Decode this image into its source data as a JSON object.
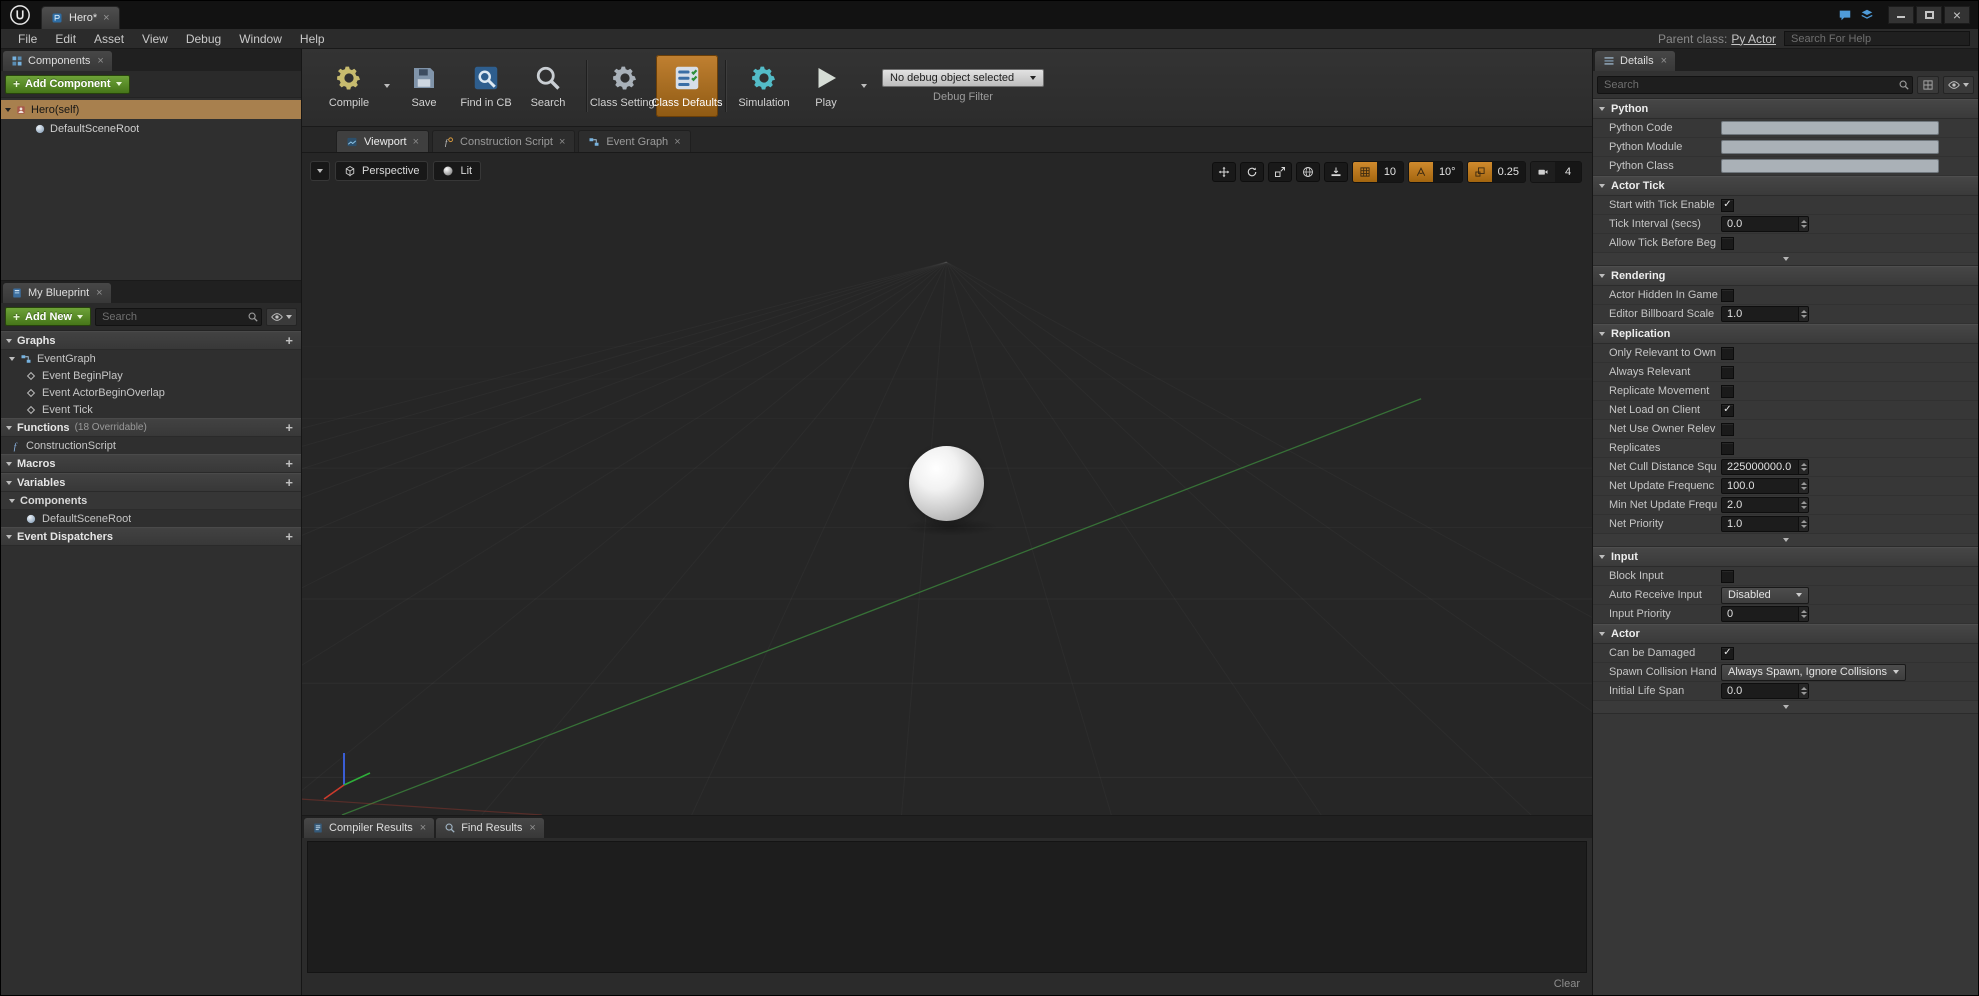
{
  "titlebar": {
    "tab_title": "Hero*"
  },
  "menubar": {
    "items": [
      "File",
      "Edit",
      "Asset",
      "View",
      "Debug",
      "Window",
      "Help"
    ],
    "parent_class_label": "Parent class:",
    "parent_class_value": "Py Actor",
    "help_search_placeholder": "Search For Help"
  },
  "components_panel": {
    "tab_label": "Components",
    "add_button_label": "Add Component",
    "tree": [
      {
        "label": "Hero(self)",
        "icon": "actor",
        "depth": 0,
        "caret": true,
        "selected": true
      },
      {
        "label": "DefaultSceneRoot",
        "icon": "scene-root",
        "depth": 1,
        "caret": false,
        "selected": false
      }
    ]
  },
  "my_blueprint_panel": {
    "tab_label": "My Blueprint",
    "add_new_label": "Add New",
    "search_placeholder": "Search",
    "sections": [
      {
        "title": "Graphs",
        "items": [
          {
            "label": "EventGraph",
            "depth": 0,
            "icon": "graph",
            "caret": true
          },
          {
            "label": "Event BeginPlay",
            "depth": 1,
            "icon": "event"
          },
          {
            "label": "Event ActorBeginOverlap",
            "depth": 1,
            "icon": "event"
          },
          {
            "label": "Event Tick",
            "depth": 1,
            "icon": "event"
          }
        ]
      },
      {
        "title": "Functions",
        "suffix": "(18 Overridable)",
        "items": [
          {
            "label": "ConstructionScript",
            "depth": 0,
            "icon": "function"
          }
        ]
      },
      {
        "title": "Macros",
        "items": []
      },
      {
        "title": "Variables",
        "items": [
          {
            "label": "Components",
            "depth": 0,
            "subheader": true,
            "caret": true
          },
          {
            "label": "DefaultSceneRoot",
            "depth": 1,
            "icon": "component"
          }
        ]
      },
      {
        "title": "Event Dispatchers",
        "items": []
      }
    ]
  },
  "toolbar": {
    "buttons": [
      {
        "label": "Compile",
        "icon": "compile",
        "has_dropdown": true
      },
      {
        "label": "Save",
        "icon": "save"
      },
      {
        "label": "Find in CB",
        "icon": "find-in-cb"
      },
      {
        "label": "Search",
        "icon": "search",
        "sep_after": true
      },
      {
        "label": "Class Settings",
        "icon": "class-settings"
      },
      {
        "label": "Class Defaults",
        "icon": "class-defaults",
        "active": true,
        "sep_after": true
      },
      {
        "label": "Simulation",
        "icon": "simulation"
      },
      {
        "label": "Play",
        "icon": "play",
        "has_dropdown": true
      }
    ],
    "debug_object_dropdown": "No debug object selected",
    "debug_filter_label": "Debug Filter"
  },
  "editor_tabs": [
    {
      "label": "Viewport",
      "icon": "viewport-tab",
      "active": true
    },
    {
      "label": "Construction Script",
      "icon": "construction-script-tab",
      "active": false
    },
    {
      "label": "Event Graph",
      "icon": "event-graph-tab",
      "active": false
    }
  ],
  "viewport": {
    "perspective_label": "Perspective",
    "lit_label": "Lit",
    "right_toolbar": [
      {
        "name": "move",
        "type": "icon"
      },
      {
        "name": "rotate",
        "type": "icon"
      },
      {
        "name": "scale",
        "type": "icon"
      },
      {
        "name": "world",
        "type": "icon"
      },
      {
        "name": "surface-snap",
        "type": "icon"
      },
      {
        "name": "grid-snap",
        "type": "chip",
        "value": "10",
        "active": true
      },
      {
        "name": "rotation-snap",
        "type": "chip",
        "value": "10°",
        "active": true
      },
      {
        "name": "scale-snap",
        "type": "chip",
        "value": "0.25",
        "active": true
      },
      {
        "name": "camera-speed",
        "type": "chip",
        "value": "4",
        "active": false
      }
    ]
  },
  "bottom_panel": {
    "tabs": [
      {
        "label": "Compiler Results",
        "icon": "compiler-results",
        "active": true
      },
      {
        "label": "Find Results",
        "icon": "find-results",
        "active": false
      }
    ],
    "clear_label": "Clear"
  },
  "details_panel": {
    "tab_label": "Details",
    "search_placeholder": "Search",
    "sections": [
      {
        "title": "Python",
        "rows": [
          {
            "label": "Python Code",
            "control": "text",
            "value": ""
          },
          {
            "label": "Python Module",
            "control": "text",
            "value": ""
          },
          {
            "label": "Python Class",
            "control": "text",
            "value": ""
          }
        ]
      },
      {
        "title": "Actor Tick",
        "expander": true,
        "rows": [
          {
            "label": "Start with Tick Enable",
            "control": "checkbox",
            "checked": true
          },
          {
            "label": "Tick Interval (secs)",
            "control": "number",
            "value": "0.0"
          },
          {
            "label": "Allow Tick Before Beg",
            "control": "checkbox",
            "checked": false
          }
        ]
      },
      {
        "title": "Rendering",
        "rows": [
          {
            "label": "Actor Hidden In Game",
            "control": "checkbox",
            "checked": false
          },
          {
            "label": "Editor Billboard Scale",
            "control": "number",
            "value": "1.0"
          }
        ]
      },
      {
        "title": "Replication",
        "expander": true,
        "rows": [
          {
            "label": "Only Relevant to Own",
            "control": "checkbox",
            "checked": false
          },
          {
            "label": "Always Relevant",
            "control": "checkbox",
            "checked": false
          },
          {
            "label": "Replicate Movement",
            "control": "checkbox",
            "checked": false
          },
          {
            "label": "Net Load on Client",
            "control": "checkbox",
            "checked": true
          },
          {
            "label": "Net Use Owner Relev",
            "control": "checkbox",
            "checked": false
          },
          {
            "label": "Replicates",
            "control": "checkbox",
            "checked": false
          },
          {
            "label": "Net Cull Distance Squ",
            "control": "number",
            "value": "225000000.0"
          },
          {
            "label": "Net Update Frequenc",
            "control": "number",
            "value": "100.0"
          },
          {
            "label": "Min Net Update Frequ",
            "control": "number",
            "value": "2.0"
          },
          {
            "label": "Net Priority",
            "control": "number",
            "value": "1.0"
          }
        ]
      },
      {
        "title": "Input",
        "rows": [
          {
            "label": "Block Input",
            "control": "checkbox",
            "checked": false
          },
          {
            "label": "Auto Receive Input",
            "control": "dropdown",
            "value": "Disabled"
          },
          {
            "label": "Input Priority",
            "control": "number",
            "value": "0"
          }
        ]
      },
      {
        "title": "Actor",
        "expander": true,
        "rows": [
          {
            "label": "Can be Damaged",
            "control": "checkbox",
            "checked": true
          },
          {
            "label": "Spawn Collision Hand",
            "control": "dropdown",
            "value": "Always Spawn, Ignore Collisions",
            "wide": true
          },
          {
            "label": "Initial Life Span",
            "control": "number",
            "value": "0.0"
          }
        ]
      }
    ]
  },
  "colors": {
    "accent_orange": "#b5742a",
    "button_green": "#5e9430",
    "selection_tan": "#a8804e"
  }
}
